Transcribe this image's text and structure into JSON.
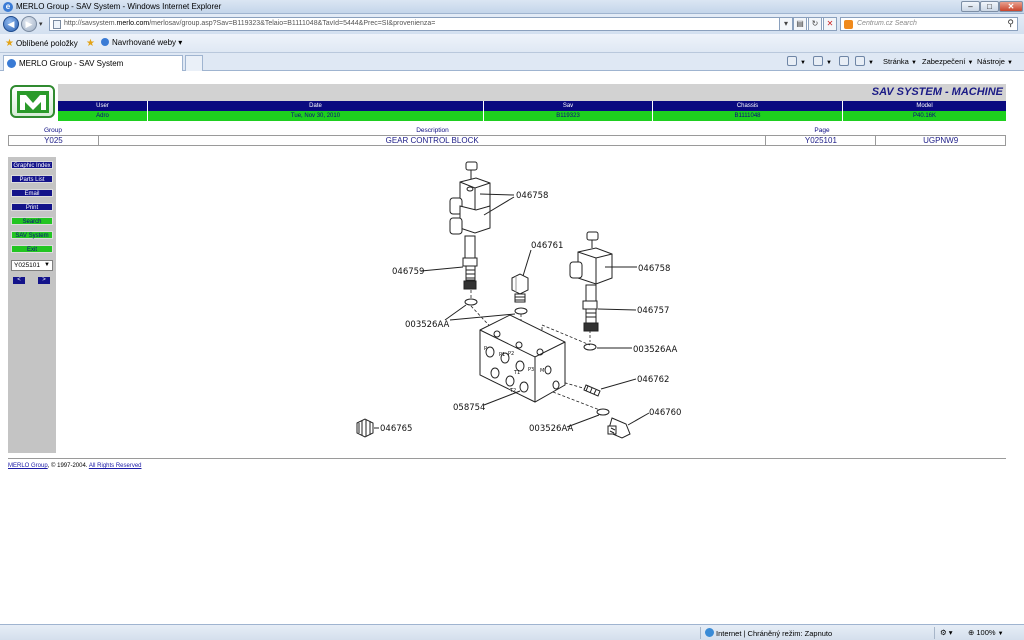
{
  "window": {
    "title": "MERLO Group - SAV System - Windows Internet Explorer",
    "minimize": "–",
    "maximize": "□",
    "close": "✕"
  },
  "browser": {
    "url_prefix": "http://savsystem.",
    "url_domain": "merlo.com",
    "url_rest": "/merlosav/group.asp?Sav=B119323&Telaio=B1111048&TavId=5444&Prec=SI&provenienza=",
    "search_placeholder": "Centrum.cz Search",
    "favorites_label": "Oblíbené položky",
    "suggested_sites_label": "Navrhované weby ▾",
    "tab_title": "MERLO Group - SAV System",
    "cmd_page": "Stránka",
    "cmd_security": "Zabezpečení",
    "cmd_tools": "Nástroje",
    "status_zone": "Internet | Chráněný režim: Zapnuto",
    "status_zoom": "100%"
  },
  "app": {
    "logo_letters": "M",
    "system_title": "SAV SYSTEM - MACHINE",
    "info_headers": [
      "User",
      "Date",
      "Sav",
      "Chassis",
      "Model"
    ],
    "info_values": [
      "Adro",
      "Tue, Nov 30, 2010",
      "B119323",
      "B1111048",
      "P40.16K"
    ],
    "group_headers": [
      "Group",
      "Description",
      "Page",
      ""
    ],
    "group_values": [
      "Y025",
      "GEAR CONTROL BLOCK",
      "Y025101",
      "UGPNW9"
    ]
  },
  "sidebar": {
    "buttons": [
      "Graphic Index",
      "Parts List",
      "Email",
      "Print",
      "Search",
      "SAV System",
      "Exit"
    ],
    "page_select_value": "Y025101",
    "prev": "<",
    "next": ">"
  },
  "diagram": {
    "part_labels": [
      "046758",
      "046761",
      "046759",
      "046758",
      "046757",
      "003526AA",
      "003526AA",
      "046762",
      "058754",
      "046760",
      "003526AA",
      "046765"
    ],
    "port_labels": [
      "P",
      "P1",
      "P2",
      "P3",
      "T1",
      "T2",
      "M"
    ]
  },
  "footer": {
    "company_link": "MERLO Group",
    "copyright": ", © 1997-2004. ",
    "rights_link": "All Rights Reserved"
  }
}
